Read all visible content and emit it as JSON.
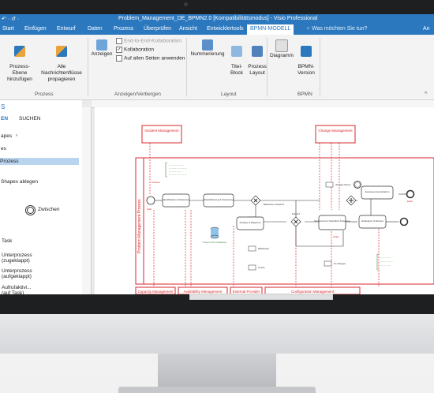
{
  "window": {
    "title": "Problem_Management_DE_BPMN2.0  [Kompatibilitätsmodus] - Visio Professional",
    "qat": "↶  ·  ↺  ·"
  },
  "tabs": {
    "items": [
      "Start",
      "Einfügen",
      "Entwurf",
      "Daten",
      "Prozess",
      "Überprüfen",
      "Ansicht",
      "Entwicklertools",
      "BPMN-MODELL"
    ],
    "active": "BPMN-MODELL",
    "tell_me": "Was möchten Sie tun?",
    "user": "An"
  },
  "ribbon": {
    "prozess_ebene": "Prozess-Ebene\nhinzufügen",
    "alle_nachrichtenfluesse": "Alle Nachrichtenflüsse\npropagieren",
    "group_prozess": "Prozess",
    "anzeigen": "Anzeigen",
    "e2e_kollaboration": "End-to-End-Kollaboration",
    "kollaboration": "Kollaboration",
    "auf_allen_seiten": "Auf allen Seiten anwenden",
    "group_anzeigen": "Anzeigen/Verbergen",
    "nummerierung": "Nummerierung",
    "titel_block": "Titel-\nBlock",
    "prozess_layout": "Prozess\nLayout",
    "group_layout": "Layout",
    "diagramm": "Diagramm",
    "bpmn_version": "BPMN-\nVersion",
    "group_bpmn": "BPMN"
  },
  "shapes_panel": {
    "header_initial": "S",
    "tab_shapes": "EN",
    "tab_search": "SUCHEN",
    "item1": "apes",
    "item2": "es",
    "item_selected": "Prozess",
    "drop_hint": "Shapes ablegen",
    "stencil_zwischen": "Zwischen",
    "stencil_task": "Task",
    "stencils": [
      "Unterprozess (zugeklappt)",
      "Unterprozess (aufgeklappt)",
      "Aufrufaktivi... (auf Task)",
      "Aufrufaktivi... (auf Prozes...",
      "Aufrufaktivi... (auf Prozes..."
    ]
  },
  "diagram": {
    "pool_label": "Problem Management Prozess",
    "top_boxes": [
      "Incident Management",
      "Change Management"
    ],
    "bottom_boxes": [
      "Capacity Management",
      "Availability Management",
      "External Provider",
      "Configuration Management"
    ],
    "tasks": [
      "Identifikation & Erfassung",
      "Klassifizierung & Zuweisung",
      "Analyse & Diagnose",
      "Workaround / behebbar Änderung",
      "Rückmeldung an Infosys",
      "Aussteuerung beheben",
      "Evaluation & Review"
    ],
    "annotations": [
      "Mitarbeiter",
      "change history",
      "Ci-info",
      "Ci changes",
      "Problem",
      "Start",
      "Ende",
      "Teilen"
    ],
    "datastore": "Known Error Database",
    "gateway_label": "Bekannte Ursache?",
    "decision_label": "Fehler?"
  },
  "colors": {
    "accent": "#2b78bf",
    "diagram_red": "#d9272e",
    "annotation_green": "#3c8c3c"
  }
}
